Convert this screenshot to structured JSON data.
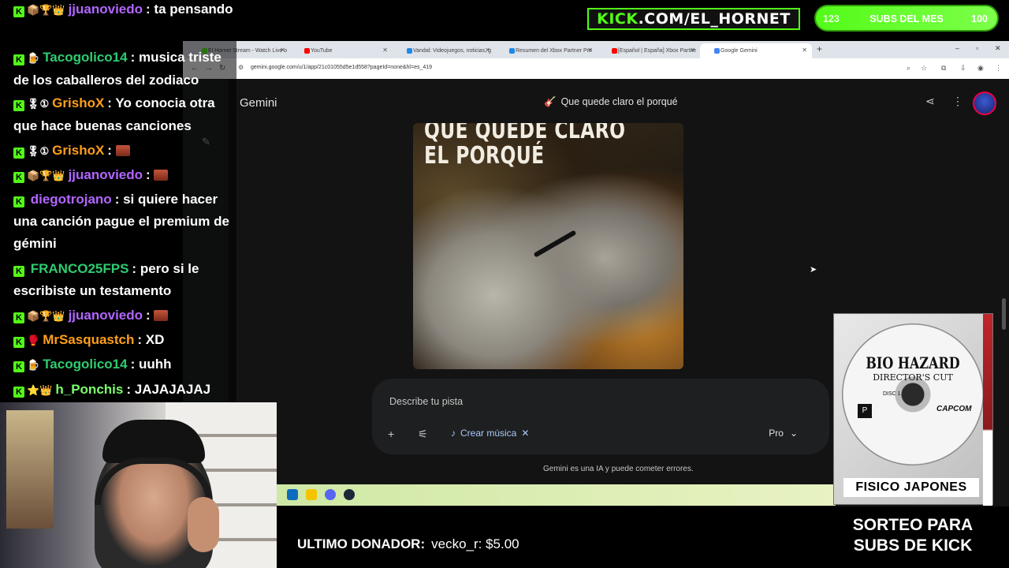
{
  "overlay": {
    "kick_banner": {
      "prefix": "KICK",
      "rest": ".COM/EL_HORNET"
    },
    "subs_goal": {
      "current": "123",
      "label": "SUBS DEL MES",
      "goal": "100"
    },
    "last_donor": {
      "label": "ULTIMO DONADOR:",
      "value": "vecko_r: $5.00"
    },
    "giveaway": {
      "line1": "SORTEO PARA",
      "line2": "SUBS DE KICK"
    },
    "game_panel": {
      "title": "BIO HAZARD",
      "subtitle": "DIRECTOR'S CUT",
      "disc": "DISC 1",
      "publisher": "CAPCOM",
      "caption": "FISICO JAPONES"
    }
  },
  "chat": [
    {
      "user": "jjuanoviedo",
      "color": "#b266ff",
      "badges": "📦🏆👑",
      "text": "ta pensando"
    },
    {
      "user": "Tacogolico14",
      "color": "#2ecc71",
      "badges": "🍺",
      "text": "musica triste de los caballeros del zodiaco"
    },
    {
      "user": "GrishoX",
      "color": "#ff9f1c",
      "badges": "🎖①",
      "text": "Yo conocia otra que hace buenas canciones"
    },
    {
      "user": "GrishoX",
      "color": "#ff9f1c",
      "badges": "🎖①",
      "text": "",
      "emote": true
    },
    {
      "user": "jjuanoviedo",
      "color": "#b266ff",
      "badges": "📦🏆👑",
      "text": "",
      "emote": true
    },
    {
      "user": "diegotrojano",
      "color": "#b266ff",
      "badges": "",
      "text": "si quiere hacer una canción pague el premium de gémini"
    },
    {
      "user": "FRANCO25FPS",
      "color": "#2ecc71",
      "badges": "",
      "text": "pero si le escribiste un testamento"
    },
    {
      "user": "jjuanoviedo",
      "color": "#b266ff",
      "badges": "📦🏆👑",
      "text": "",
      "emote": true
    },
    {
      "user": "MrSasquastch",
      "color": "#ff9f1c",
      "badges": "🥊",
      "text": "XD"
    },
    {
      "user": "Tacogolico14",
      "color": "#2ecc71",
      "badges": "🍺",
      "text": "uuhh"
    },
    {
      "user": "h_Ponchis",
      "color": "#7cff6b",
      "badges": "⭐👑",
      "text": "JAJAJAJAJ"
    }
  ],
  "browser": {
    "tabs": [
      {
        "label": "El Hornet Stream - Watch Live o",
        "fav": "#53fc18"
      },
      {
        "label": "YouTube",
        "fav": "#ff0000"
      },
      {
        "label": "Vandal: Videojuegos, noticias, g",
        "fav": "#1e88e5"
      },
      {
        "label": "Resumen del Xbox Partner Pre",
        "fav": "#1e88e5"
      },
      {
        "label": "[Español | España] Xbox Partne",
        "fav": "#ff0000"
      },
      {
        "label": "Google Gemini",
        "fav": "#4285f4"
      }
    ],
    "url": "gemini.google.com/u/1/app/21c01055d5e1d558?pageId=none&hl=es_419"
  },
  "gemini": {
    "app_name": "Gemini",
    "chat_title": "Que quede claro el porqué",
    "cover_title_line1": "QUE QUEDE CLARO",
    "cover_title_line2": "EL PORQUÉ",
    "prompt_placeholder": "Describe tu pista",
    "chip_label": "Crear música",
    "model_label": "Pro",
    "disclaimer": "Gemini es una IA y puede cometer errores."
  }
}
